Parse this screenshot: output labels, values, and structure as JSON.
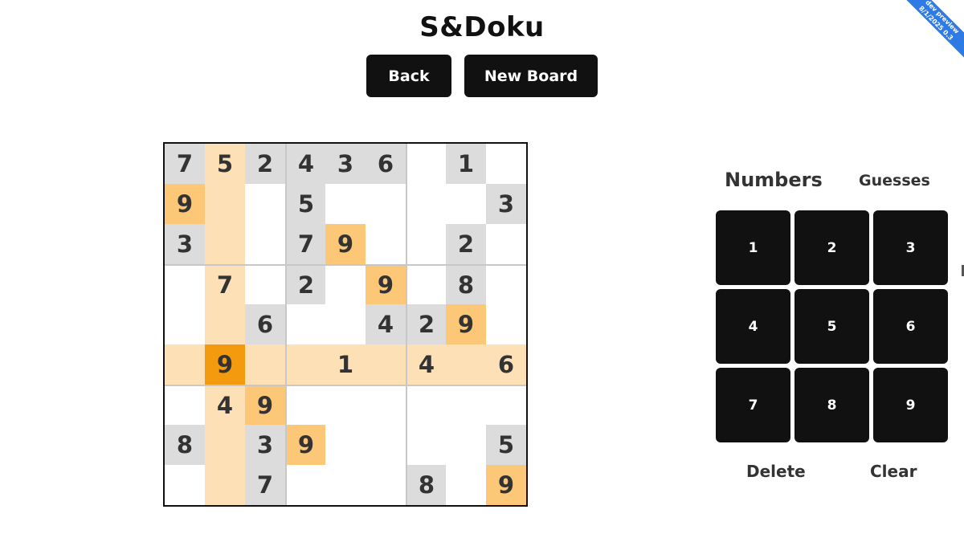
{
  "app": {
    "title": "S&Doku"
  },
  "toolbar": {
    "back_label": "Back",
    "new_board_label": "New Board"
  },
  "board": {
    "rows": [
      [
        "7",
        "5",
        "2",
        "4",
        "3",
        "6",
        "",
        "1",
        ""
      ],
      [
        "9",
        "",
        "",
        "5",
        "",
        "",
        "",
        "",
        "3"
      ],
      [
        "3",
        "",
        "",
        "7",
        "9",
        "",
        "",
        "2",
        ""
      ],
      [
        "",
        "7",
        "",
        "2",
        "",
        "9",
        "",
        "8",
        ""
      ],
      [
        "",
        "",
        "6",
        "",
        "",
        "4",
        "2",
        "9",
        ""
      ],
      [
        "",
        "9",
        "",
        "",
        "1",
        "",
        "4",
        "",
        "6"
      ],
      [
        "",
        "4",
        "9",
        "",
        "",
        "",
        "",
        "",
        ""
      ],
      [
        "8",
        "",
        "3",
        "9",
        "",
        "",
        "",
        "",
        "5"
      ],
      [
        "",
        "",
        "7",
        "",
        "",
        "",
        "8",
        "",
        "9"
      ]
    ],
    "states": [
      [
        "given",
        "hl",
        "given",
        "given",
        "given",
        "given",
        "",
        "given",
        ""
      ],
      [
        "match",
        "hl",
        "",
        "given",
        "",
        "",
        "",
        "",
        "given"
      ],
      [
        "given",
        "hl",
        "",
        "given",
        "match",
        "",
        "",
        "given",
        ""
      ],
      [
        "",
        "hl",
        "",
        "given",
        "",
        "match",
        "",
        "given",
        ""
      ],
      [
        "",
        "hl",
        "given",
        "",
        "",
        "given",
        "given",
        "match",
        ""
      ],
      [
        "hl",
        "sel",
        "hl",
        "hl",
        "hl",
        "hl",
        "hl",
        "hl",
        "hl"
      ],
      [
        "",
        "hl",
        "match",
        "",
        "",
        "",
        "",
        "",
        ""
      ],
      [
        "given",
        "hl",
        "given",
        "match",
        "",
        "",
        "",
        "",
        "given"
      ],
      [
        "",
        "hl",
        "given",
        "",
        "",
        "",
        "given",
        "",
        "match"
      ]
    ],
    "selected": {
      "row": 6,
      "col": 2,
      "value": 9
    }
  },
  "panel": {
    "numbers_tab": "Numbers",
    "guesses_tab": "Guesses",
    "active_tab": "Numbers",
    "keys": [
      "1",
      "2",
      "3",
      "4",
      "5",
      "6",
      "7",
      "8",
      "9"
    ],
    "delete_label": "Delete",
    "clear_label": "Clear"
  },
  "colors": {
    "given": "#dcdcdc",
    "highlight": "#fde0b6",
    "match": "#fcc777",
    "selected": "#f39a0e",
    "button": "#111111"
  },
  "banner": {
    "line1": "dev preview",
    "line2": "8/1/2025 0.3"
  }
}
